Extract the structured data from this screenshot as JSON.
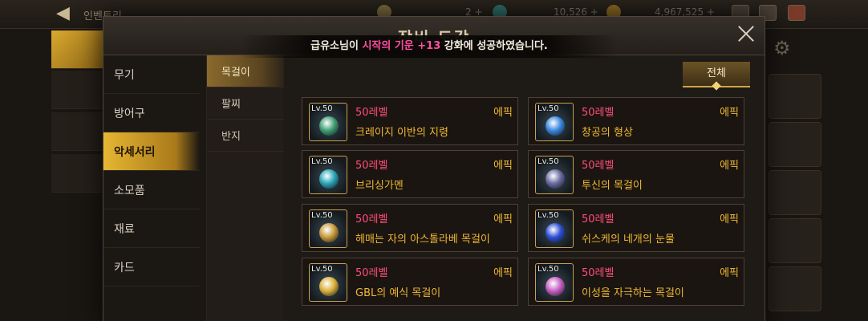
{
  "background": {
    "crumb": "인벤토리",
    "resources": [
      "2 +",
      "10,526 +",
      "4,967,525 +"
    ]
  },
  "modal": {
    "title": "장비 도감",
    "toast": {
      "prefix": "급유소님이 ",
      "item": "시작의 기운 +13",
      "suffix": " 강화에 성공하였습니다."
    }
  },
  "categories": [
    {
      "label": "무기"
    },
    {
      "label": "방어구"
    },
    {
      "label": "악세서리",
      "active": true
    },
    {
      "label": "소모품"
    },
    {
      "label": "재료"
    },
    {
      "label": "카드"
    }
  ],
  "subcategories": [
    {
      "label": "목걸이",
      "active": true
    },
    {
      "label": "팔찌"
    },
    {
      "label": "반지"
    }
  ],
  "filter": {
    "label": "전체"
  },
  "items": [
    {
      "lv": "Lv.50",
      "level": "50레벨",
      "rarity": "에픽",
      "name": "크레이지 이반의 지령",
      "icon": "emerald-ring-icon",
      "color": "#3f9e73"
    },
    {
      "lv": "Lv.50",
      "level": "50레벨",
      "rarity": "에픽",
      "name": "창공의 형상",
      "icon": "blue-orb-necklace-icon",
      "color": "#3a88e0"
    },
    {
      "lv": "Lv.50",
      "level": "50레벨",
      "rarity": "에픽",
      "name": "브리싱가멘",
      "icon": "jeweled-collar-icon",
      "color": "#2aa6b7"
    },
    {
      "lv": "Lv.50",
      "level": "50레벨",
      "rarity": "에픽",
      "name": "투신의 목걸이",
      "icon": "demon-mask-necklace-icon",
      "color": "#6a6aa0"
    },
    {
      "lv": "Lv.50",
      "level": "50레벨",
      "rarity": "에픽",
      "name": "헤매는 자의 아스톨라베 목걸이",
      "icon": "astrolabe-icon",
      "color": "#c79a3a"
    },
    {
      "lv": "Lv.50",
      "level": "50레벨",
      "rarity": "에픽",
      "name": "쉬스케의 네개의 눈물",
      "icon": "sapphire-cluster-icon",
      "color": "#2d4fd6"
    },
    {
      "lv": "Lv.50",
      "level": "50레벨",
      "rarity": "에픽",
      "name": "GBL의 예식 목걸이",
      "icon": "golden-scroll-icon",
      "color": "#d9b03a"
    },
    {
      "lv": "Lv.50",
      "level": "50레벨",
      "rarity": "에픽",
      "name": "이성을 자극하는 목걸이",
      "icon": "pink-pendant-icon",
      "color": "#c75fc2"
    }
  ]
}
